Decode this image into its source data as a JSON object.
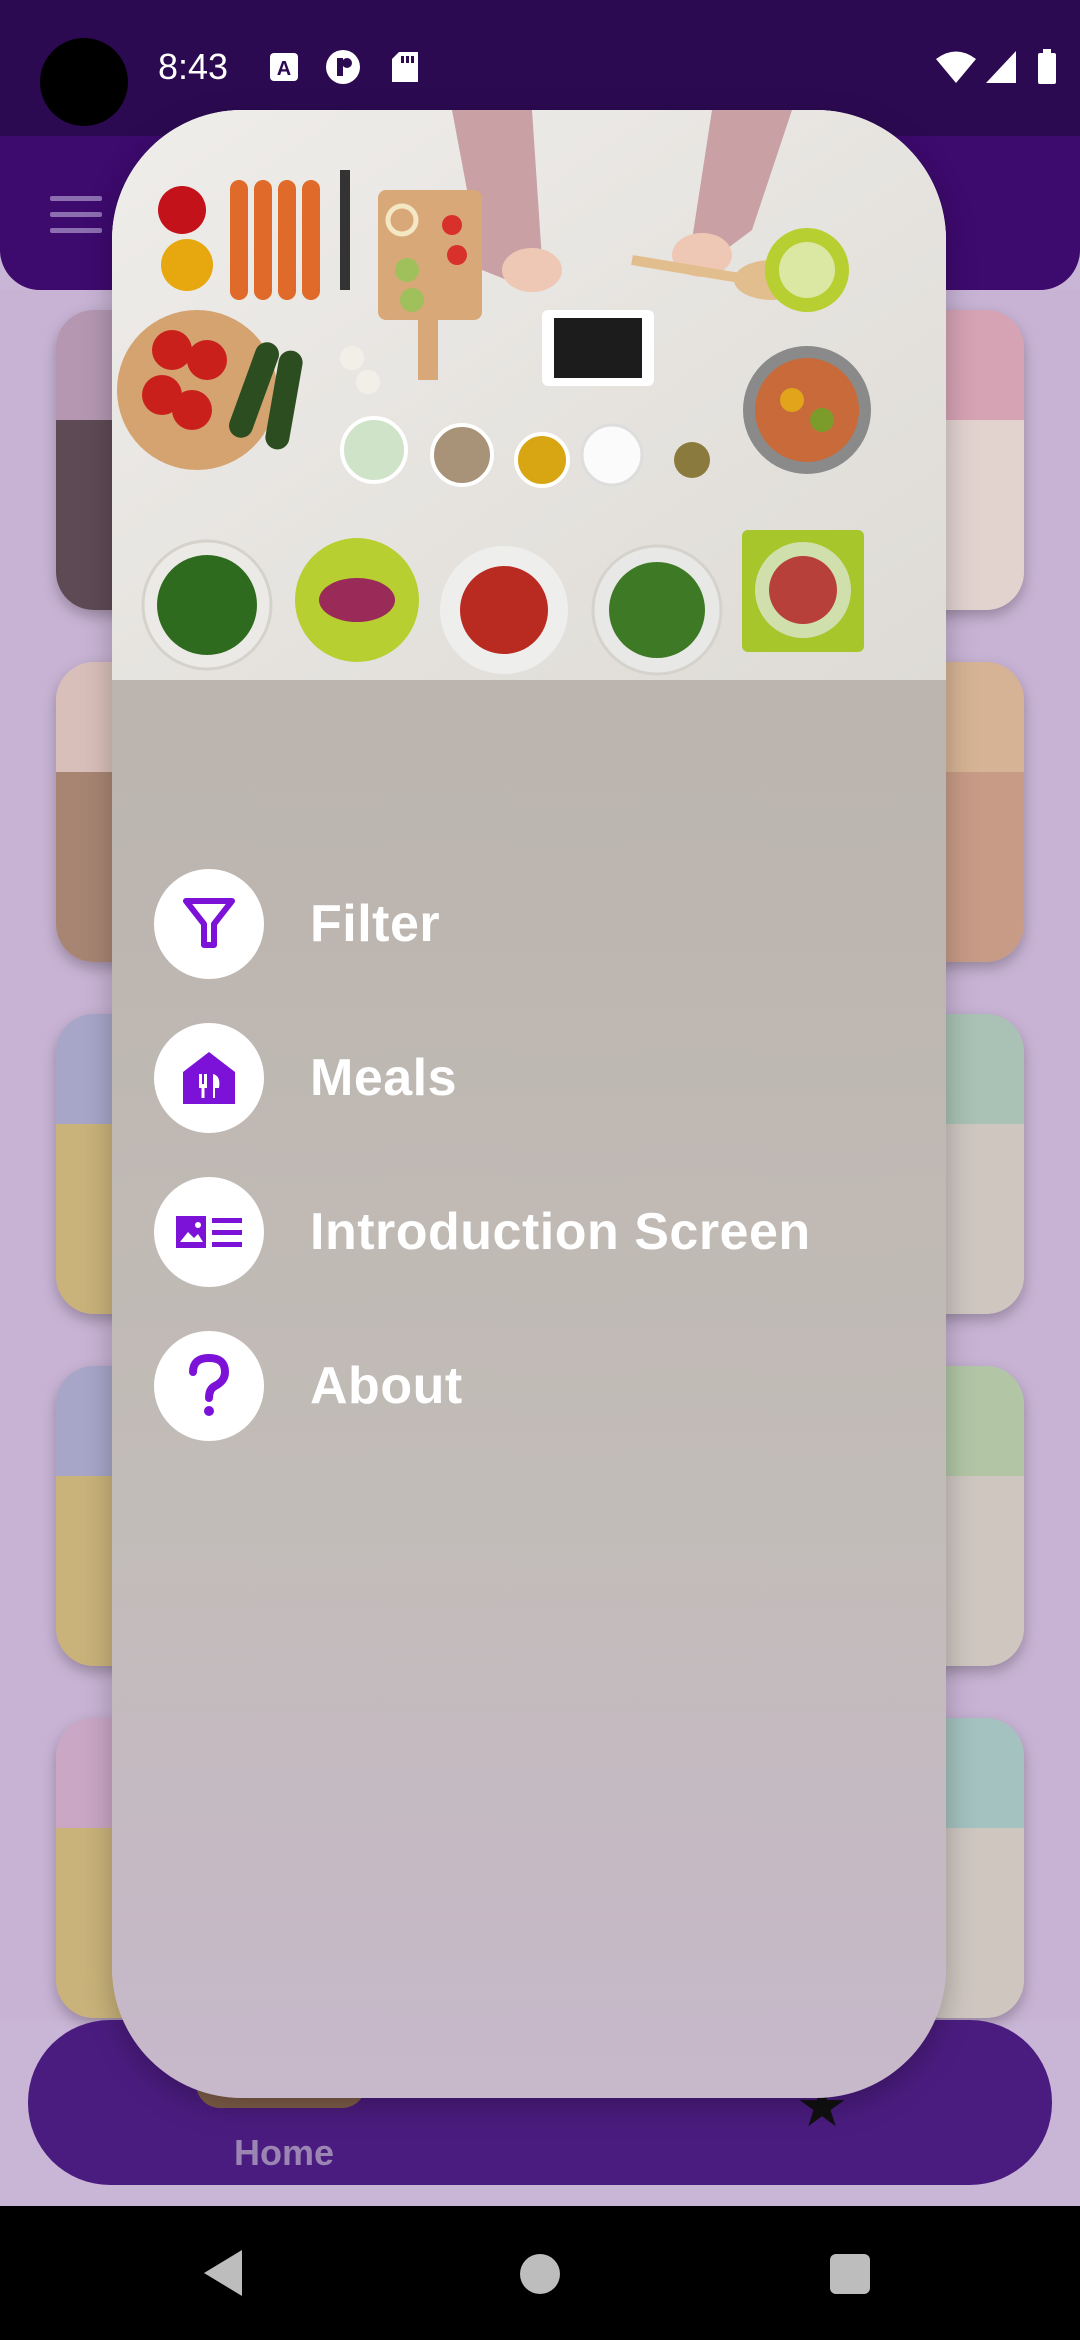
{
  "status_bar": {
    "time": "8:43",
    "icons_left": [
      "a-notification-icon",
      "circle-app-icon",
      "sd-card-icon"
    ],
    "icons_right": [
      "wifi-icon",
      "signal-icon",
      "battery-icon"
    ]
  },
  "app_bar": {
    "menu_icon": "hamburger-menu-icon"
  },
  "drawer": {
    "header_image": "vegetables-on-table-image",
    "items": [
      {
        "label": "Filter",
        "icon": "filter-icon"
      },
      {
        "label": "Meals",
        "icon": "meals-icon"
      },
      {
        "label": "Introduction Screen",
        "icon": "article-icon"
      },
      {
        "label": "About",
        "icon": "help-icon"
      }
    ]
  },
  "bottom_nav": {
    "home_label": "Home",
    "favorites_icon": "star-icon"
  },
  "colors": {
    "primary": "#3d0a6e",
    "accent": "#7c12d8",
    "status_bar": "#2c0a52"
  }
}
